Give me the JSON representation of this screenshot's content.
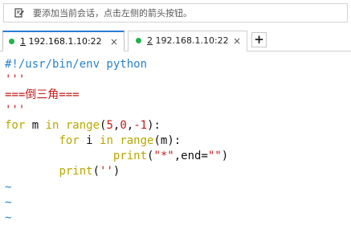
{
  "hint": {
    "icon": "pencil-note-icon",
    "text": "要添加当前会话，点击左侧的箭头按钮。"
  },
  "tabs": [
    {
      "index": "1",
      "host": " 192.168.1.10:22",
      "active": true,
      "status_color": "#22b14c"
    },
    {
      "index": "2",
      "host": " 192.168.1.10:22",
      "active": false,
      "status_color": "#22b14c"
    }
  ],
  "tab_close_glyph": "×",
  "add_tab_glyph": "+",
  "code": {
    "line1": "#!/usr/bin/env python",
    "line2": "'''",
    "line3": "===倒三角===",
    "line4": "'''",
    "line5": {
      "kw_for": "for",
      "var_m": " m ",
      "kw_in": "in",
      "fn_range": " range",
      "paren_open": "(",
      "n5": "5",
      "comma1": ",",
      "n0": "0",
      "comma2": ",",
      "nm1": "-1",
      "paren_close": "):"
    },
    "line6": {
      "indent": "        ",
      "kw_for": "for",
      "var_i": " i ",
      "kw_in": "in",
      "fn_range": " range",
      "args": "(m):"
    },
    "line7": {
      "indent": "                ",
      "fn_print": "print",
      "p_open": "(",
      "str_star": "\"*\"",
      "end_kw": ",end=",
      "str_empty": "\"\"",
      "p_close": ")"
    },
    "line8": {
      "indent": "        ",
      "fn_print": "print",
      "p_open": "(",
      "str_empty": "''",
      "p_close": ")"
    },
    "tildes": [
      "~",
      "~",
      "~"
    ]
  }
}
